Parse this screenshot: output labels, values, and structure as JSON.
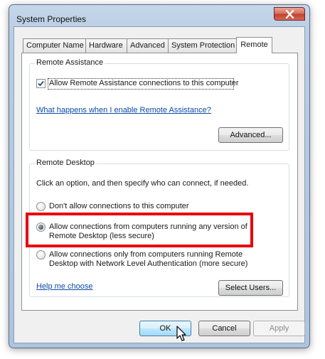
{
  "window": {
    "title": "System Properties"
  },
  "tabs": [
    {
      "label": "Computer Name",
      "active": false
    },
    {
      "label": "Hardware",
      "active": false
    },
    {
      "label": "Advanced",
      "active": false
    },
    {
      "label": "System Protection",
      "active": false
    },
    {
      "label": "Remote",
      "active": true
    }
  ],
  "remote_assistance": {
    "group_label": "Remote Assistance",
    "allow_checkbox_label": "Allow Remote Assistance connections to this computer",
    "allow_checked": true,
    "help_link": "What happens when I enable Remote Assistance?",
    "advanced_button": "Advanced..."
  },
  "remote_desktop": {
    "group_label": "Remote Desktop",
    "instructions": "Click an option, and then specify who can connect, if needed.",
    "options": [
      {
        "label": "Don't allow connections to this computer",
        "selected": false
      },
      {
        "label_line1": "Allow connections from computers running any version of",
        "label_line2": "Remote Desktop (less secure)",
        "selected": true
      },
      {
        "label_line1": "Allow connections only from computers running Remote",
        "label_line2": "Desktop with Network Level Authentication (more secure)",
        "selected": false
      }
    ],
    "help_link": "Help me choose",
    "select_users_button": "Select Users..."
  },
  "footer": {
    "ok_button": "OK",
    "cancel_button": "Cancel",
    "apply_button": "Apply",
    "apply_enabled": false
  },
  "colors": {
    "highlight": "#e8000b",
    "link": "#0b49a8"
  },
  "icons": [
    "close-icon",
    "checkmark-icon",
    "mouse-cursor-icon"
  ]
}
